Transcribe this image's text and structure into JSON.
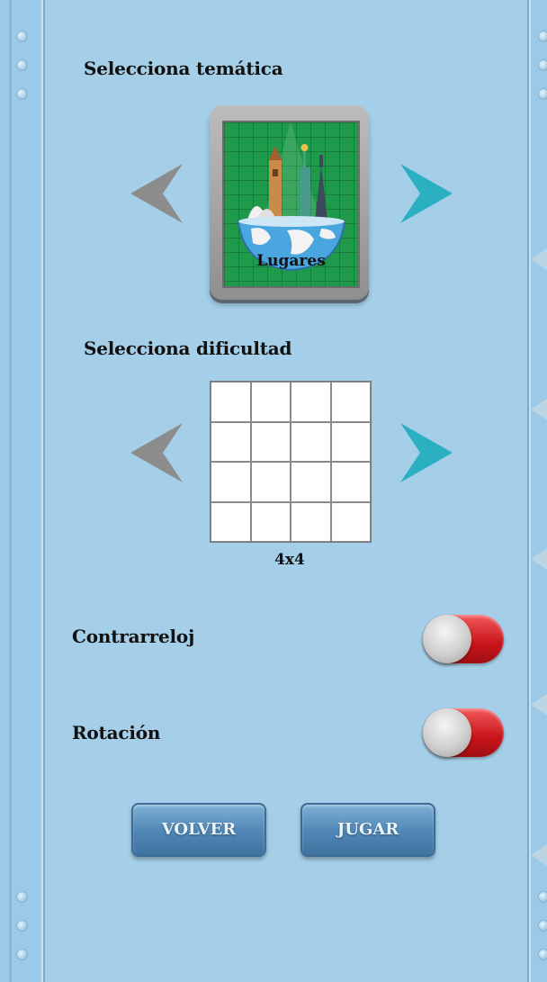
{
  "theme": {
    "heading": "Selecciona temática",
    "selected_label": "Lugares"
  },
  "difficulty": {
    "heading": "Selecciona dificultad",
    "selected_label": "4x4",
    "grid_size": 4
  },
  "options": {
    "timer_label": "Contrarreloj",
    "timer_on": true,
    "rotation_label": "Rotación",
    "rotation_on": true
  },
  "buttons": {
    "back_label": "VOLVER",
    "play_label": "JUGAR"
  },
  "colors": {
    "background": "#a5cfe8",
    "arrow_active": "#2bb0c2",
    "arrow_inactive": "#8c8c8c",
    "toggle_on": "#d21a1f",
    "button": "#4f86b5"
  },
  "icons": {
    "prev": "chevron-left-icon",
    "next": "chevron-right-icon",
    "theme": "world-landmarks-icon"
  }
}
